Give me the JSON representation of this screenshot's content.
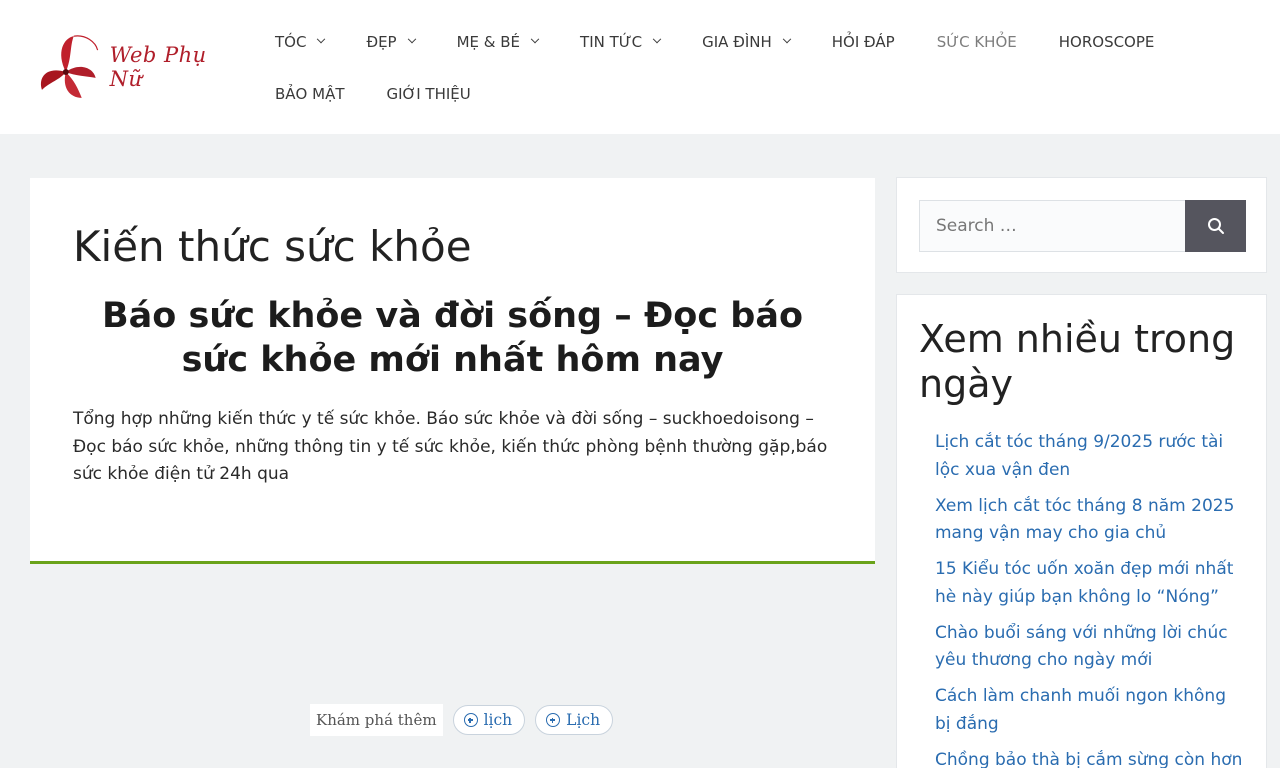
{
  "header": {
    "logo_text": "Web Phụ Nữ",
    "nav_row1": [
      {
        "label": "TÓC",
        "dropdown": true
      },
      {
        "label": "ĐẸP",
        "dropdown": true
      },
      {
        "label": "MẸ & BÉ",
        "dropdown": true
      },
      {
        "label": "TIN TỨC",
        "dropdown": true
      },
      {
        "label": "GIA ĐÌNH",
        "dropdown": true
      },
      {
        "label": "HỎI ĐÁP",
        "dropdown": false
      },
      {
        "label": "SỨC KHỎE",
        "dropdown": false,
        "active": true
      },
      {
        "label": "HOROSCOPE",
        "dropdown": false
      }
    ],
    "nav_row2": [
      {
        "label": "BẢO MẬT",
        "dropdown": false
      },
      {
        "label": "GIỚI THIỆU",
        "dropdown": false
      }
    ]
  },
  "main": {
    "page_title": "Kiến thức sức khỏe",
    "sub_title": "Báo sức khỏe và đời sống – Đọc báo sức khỏe mới nhất hôm nay",
    "description": "Tổng hợp những kiến thức y tế sức khỏe. Báo sức khỏe và đời sống – suckhoedoisong – Đọc báo sức khỏe, những thông tin y tế sức khỏe, kiến thức phòng bệnh thường gặp,báo sức khỏe điện tử 24h qua"
  },
  "explore": {
    "label": "Khám phá thêm",
    "chips": [
      "lịch",
      "Lịch"
    ]
  },
  "sidebar": {
    "search": {
      "placeholder": "Search …"
    },
    "popular": {
      "title": "Xem nhiều trong ngày",
      "items": [
        "Lịch cắt tóc tháng 9/2025 rước tài lộc xua vận đen",
        "Xem lịch cắt tóc tháng 8 năm 2025 mang vận may cho gia chủ",
        "15 Kiểu tóc uốn xoăn đẹp mới nhất hè này giúp bạn không lo “Nóng”",
        "Chào buổi sáng với những lời chúc yêu thương cho ngày mới",
        "Cách làm chanh muối ngon không bị đắng",
        "Chồng bảo thà bị cắm sừng còn hơn"
      ]
    }
  },
  "colors": {
    "accent_green": "#6aa31a",
    "link_blue": "#2a6cb0",
    "logo_red": "#b01e2a",
    "search_button": "#55555e"
  }
}
